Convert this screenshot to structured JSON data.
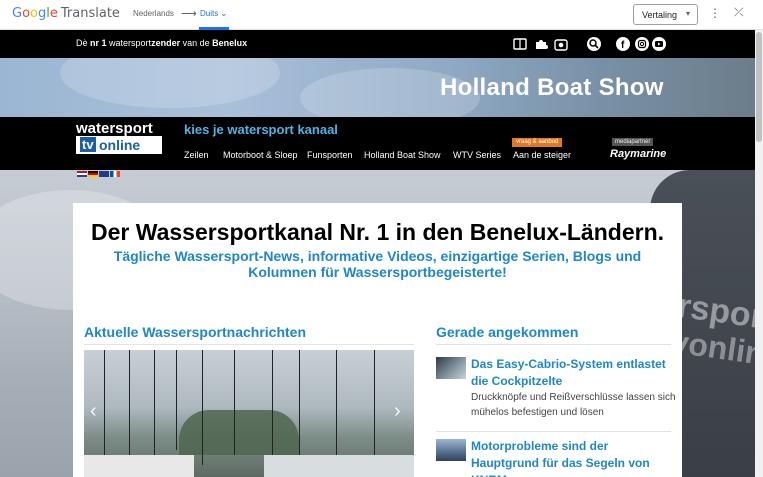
{
  "translate_bar": {
    "logo_google": [
      "G",
      "o",
      "o",
      "g",
      "l",
      "e"
    ],
    "logo_translate": "Translate",
    "source_language": "Nederlands",
    "arrow": "⟶",
    "target_language": "Duits",
    "target_chevron": "⌄",
    "button_label": "Vertaling",
    "button_chevron": "▾",
    "more_icon": "⋮",
    "close_icon": "⤫"
  },
  "site": {
    "tagline_pre": "Dè ",
    "tagline_nr": "nr 1",
    "tagline_mid1": " watersport",
    "tagline_zender": "zender",
    "tagline_mid2": " van de ",
    "tagline_benelux": "Benelux",
    "hero_title": "Holland Boat Show",
    "logo_line1": "watersport",
    "logo_tv": "tv",
    "logo_online": "online",
    "channel_slogan": "kies je watersport kanaal",
    "nav": [
      {
        "label": "Zeilen"
      },
      {
        "label": "Motorboot & Sloep"
      },
      {
        "label": "Funsporten"
      },
      {
        "label": "Holland Boat Show"
      },
      {
        "label": "WTV Series"
      },
      {
        "label": "Aan de steiger"
      }
    ],
    "nav_badge": "vraag & aanbod",
    "mediapartner_label": "mediapartner",
    "sponsor": "Raymarine",
    "watermark_line1": "watersport",
    "watermark_line2": "tvonline"
  },
  "content": {
    "headline": "Der Wassersportkanal Nr. 1 in den Benelux-Ländern.",
    "subheadline": "Tägliche Wassersport-News, informative Videos, einzigartige Serien, Blogs und Kolumnen für Wassersportbegeisterte!",
    "news_section_title": "Aktuelle Wassersportnachrichten",
    "new_section_title": "Gerade angekommen",
    "slider_prev": "‹",
    "slider_next": "›",
    "articles": [
      {
        "title": "Das Easy-Cabrio-System entlastet die Cockpitzelte",
        "desc": "Druckknöpfe und Reißverschlüsse lassen sich mühelos befestigen und lösen"
      },
      {
        "title": "Motorprobleme sind der Hauptgrund für das Segeln von KNRM",
        "desc": ""
      }
    ]
  },
  "colors": {
    "accent_blue": "#1e87c8",
    "google_blue": "#1a73e8",
    "slogan_blue": "#4fb3e8",
    "badge_orange": "#e07a1f"
  },
  "icons": [
    "book-icon",
    "puzzle-icon",
    "camera-icon",
    "search-icon",
    "facebook-icon",
    "instagram-icon",
    "youtube-icon"
  ]
}
